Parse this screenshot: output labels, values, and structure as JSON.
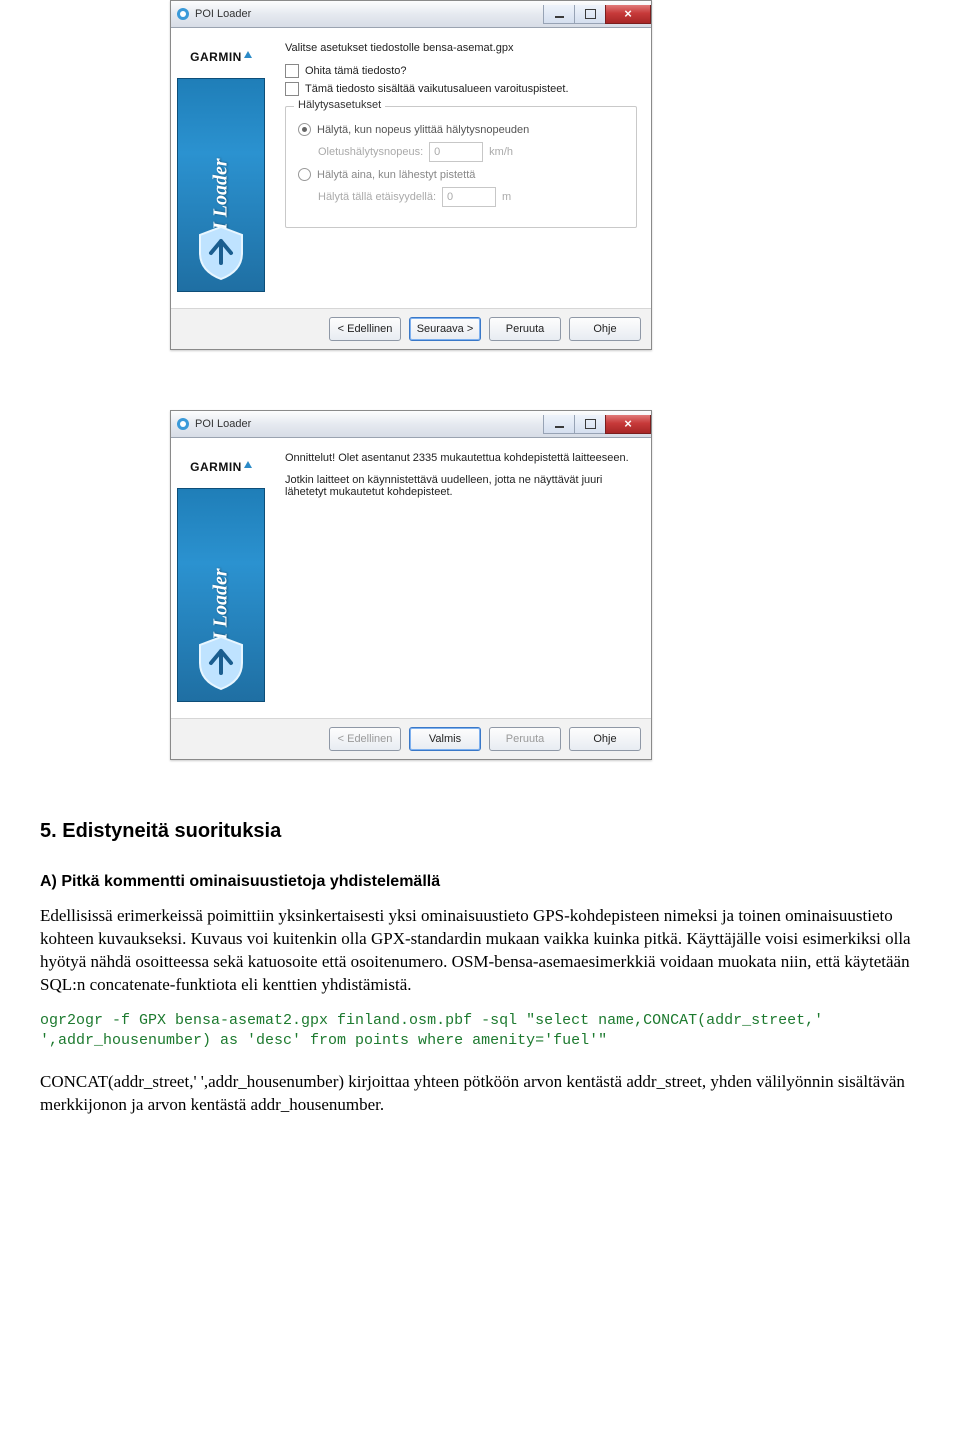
{
  "window1": {
    "title": "POI Loader",
    "sidebar_label": "POI Loader",
    "garmin": "GARMIN",
    "top_line": "Valitse asetukset tiedostolle bensa-asemat.gpx",
    "check1": "Ohita tämä tiedosto?",
    "check2": "Tämä tiedosto sisältää vaikutusalueen varoituspisteet.",
    "group_legend": "Hälytysasetukset",
    "radio1": "Hälytä, kun nopeus ylittää hälytysnopeuden",
    "speed_label": "Oletushälytysnopeus:",
    "speed_value": "0",
    "speed_unit": "km/h",
    "radio2": "Hälytä aina, kun lähestyt pistettä",
    "dist_label": "Hälytä tällä etäisyydellä:",
    "dist_value": "0",
    "dist_unit": "m",
    "btn_back": "< Edellinen",
    "btn_next": "Seuraava >",
    "btn_cancel": "Peruuta",
    "btn_help": "Ohje"
  },
  "window2": {
    "title": "POI Loader",
    "sidebar_label": "POI Loader",
    "garmin": "GARMIN",
    "congrats": "Onnittelut! Olet asentanut 2335 mukautettua kohdepistettä laitteeseen.",
    "note": "Jotkin laitteet on käynnistettävä uudelleen, jotta ne näyttävät juuri lähetetyt mukautetut kohdepisteet.",
    "btn_back": "< Edellinen",
    "btn_finish": "Valmis",
    "btn_cancel": "Peruuta",
    "btn_help": "Ohje"
  },
  "doc": {
    "h2": "5. Edistyneitä suorituksia",
    "h3": "A) Pitkä kommentti ominaisuustietoja yhdistelemällä",
    "p1": "Edellisissä erimerkeissä poimittiin yksinkertaisesti yksi ominaisuustieto GPS-kohdepisteen nimeksi ja toinen ominaisuustieto kohteen kuvaukseksi.  Kuvaus voi kuitenkin olla GPX-standardin mukaan vaikka kuinka pitkä.  Käyttäjälle voisi esimerkiksi olla hyötyä nähdä osoitteessa sekä katuosoite että osoitenumero.  OSM-bensa-asemaesimerkkiä voidaan muokata niin, että käytetään SQL:n concatenate-funktiota eli kenttien yhdistämistä.",
    "code": "ogr2ogr -f GPX bensa-asemat2.gpx finland.osm.pbf -sql \"select name,CONCAT(addr_street,' ',addr_housenumber) as 'desc' from points where amenity='fuel'\"",
    "p2": "CONCAT(addr_street,' ',addr_housenumber) kirjoittaa yhteen pötköön arvon kentästä addr_street, yhden välilyönnin sisältävän merkkijonon ja arvon kentästä addr_housenumber."
  }
}
